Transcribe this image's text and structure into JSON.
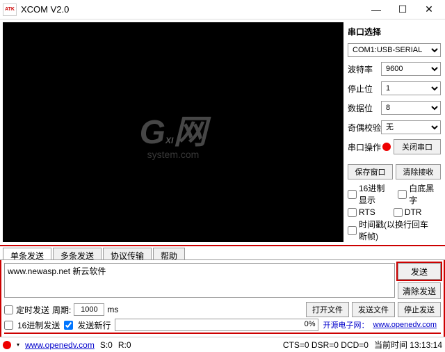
{
  "window": {
    "title": "XCOM V2.0",
    "logo_text": "ATK"
  },
  "side": {
    "port_label": "串口选择",
    "port_value": "COM1:USB-SERIAL",
    "baud_label": "波特率",
    "baud_value": "9600",
    "stop_label": "停止位",
    "stop_value": "1",
    "data_label": "数据位",
    "data_value": "8",
    "parity_label": "奇偶校验",
    "parity_value": "无",
    "op_label": "串口操作",
    "op_button": "关闭串口",
    "save_window": "保存窗口",
    "clear_recv": "清除接收",
    "hex_display": "16进制显示",
    "white_black": "白底黑字",
    "rts": "RTS",
    "dtr": "DTR",
    "timestamp": "时间戳(以换行回车断帧)"
  },
  "tabs": {
    "single": "单条发送",
    "multi": "多条发送",
    "protocol": "协议传输",
    "help": "帮助"
  },
  "send": {
    "text": "www.newasp.net 新云软件",
    "send_btn": "发送",
    "clear_btn": "清除发送",
    "timed_send": "定时发送",
    "period_label": "周期:",
    "period_value": "1000",
    "period_unit": "ms",
    "open_file": "打开文件",
    "send_file": "发送文件",
    "stop_send": "停止发送",
    "hex_send": "16进制发送",
    "send_newline": "发送新行",
    "progress": "0%",
    "link_label": "开源电子网：",
    "link_url": "www.openedv.com"
  },
  "status": {
    "url": "www.openedv.com",
    "s": "S:0",
    "r": "R:0",
    "cts": "CTS=0 DSR=0 DCD=0",
    "time_label": "当前时间 13:13:14"
  }
}
